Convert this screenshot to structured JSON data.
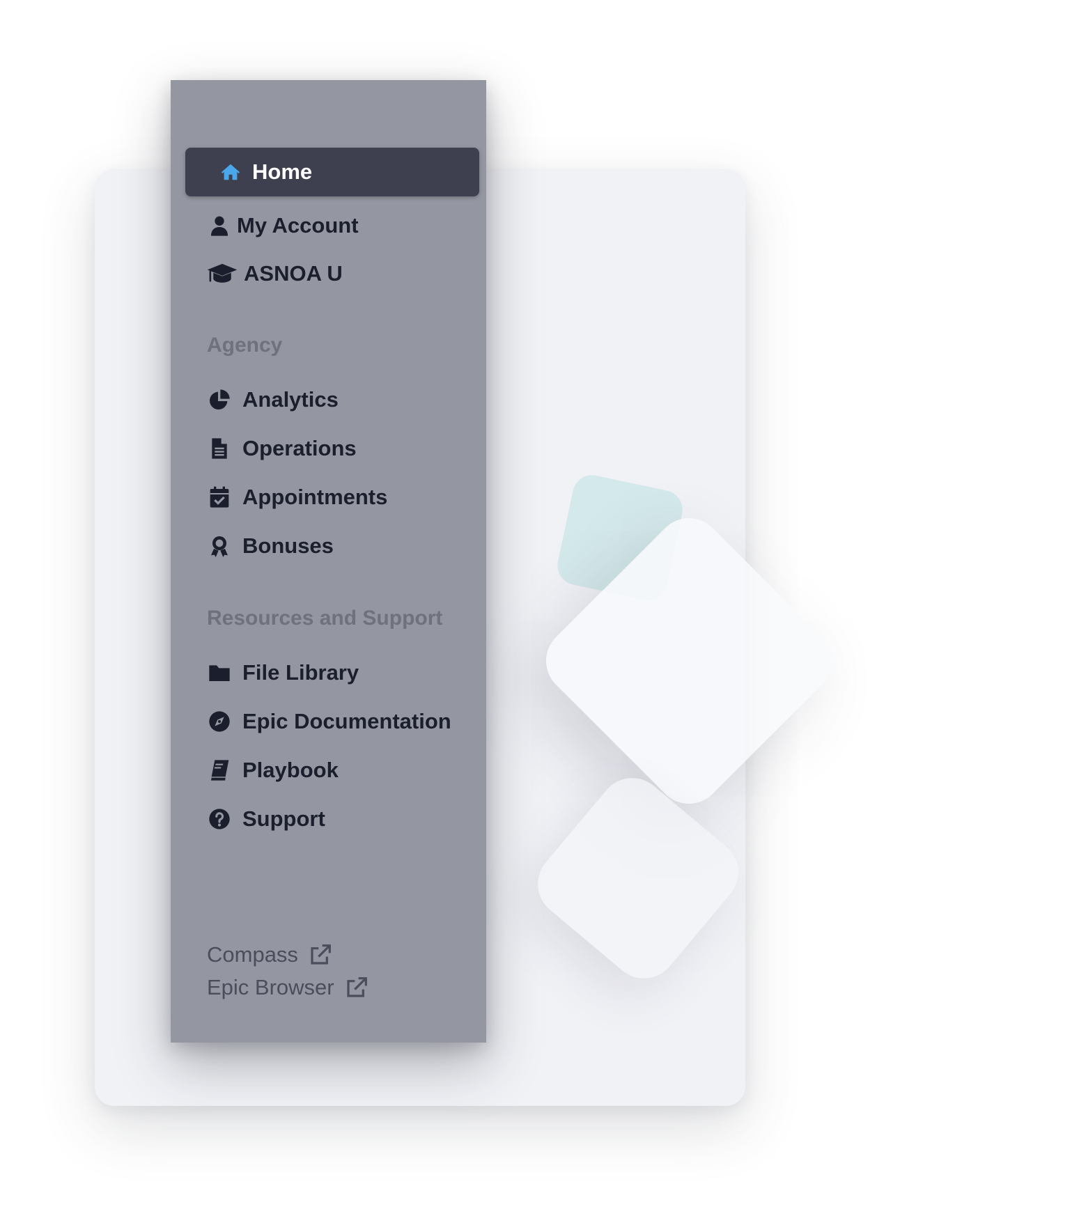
{
  "sidebar": {
    "active_item": {
      "label": "Home",
      "icon": "home-icon"
    },
    "primary_items": [
      {
        "label": "My Account",
        "icon": "user-icon"
      },
      {
        "label": "ASNOA U",
        "icon": "graduation-cap-icon"
      }
    ],
    "sections": [
      {
        "header": "Agency",
        "items": [
          {
            "label": "Analytics",
            "icon": "pie-chart-icon"
          },
          {
            "label": "Operations",
            "icon": "document-icon"
          },
          {
            "label": "Appointments",
            "icon": "calendar-check-icon"
          },
          {
            "label": "Bonuses",
            "icon": "award-icon"
          }
        ]
      },
      {
        "header": "Resources and Support",
        "items": [
          {
            "label": "File Library",
            "icon": "folder-icon"
          },
          {
            "label": "Epic Documentation",
            "icon": "compass-icon"
          },
          {
            "label": "Playbook",
            "icon": "book-icon"
          },
          {
            "label": "Support",
            "icon": "question-circle-icon"
          }
        ]
      }
    ],
    "external_links": [
      {
        "label": "Compass",
        "icon": "external-link-icon"
      },
      {
        "label": "Epic Browser",
        "icon": "external-link-icon"
      }
    ]
  },
  "colors": {
    "sidebar_bg": "#9496a1",
    "active_bg": "#3e404f",
    "active_text": "#ffffff",
    "home_icon": "#4aa8ea",
    "item_text": "#1b1e2c",
    "section_header": "#6f717d",
    "link_text": "#4b4d5c",
    "backdrop_card": "#f1f2f6"
  }
}
